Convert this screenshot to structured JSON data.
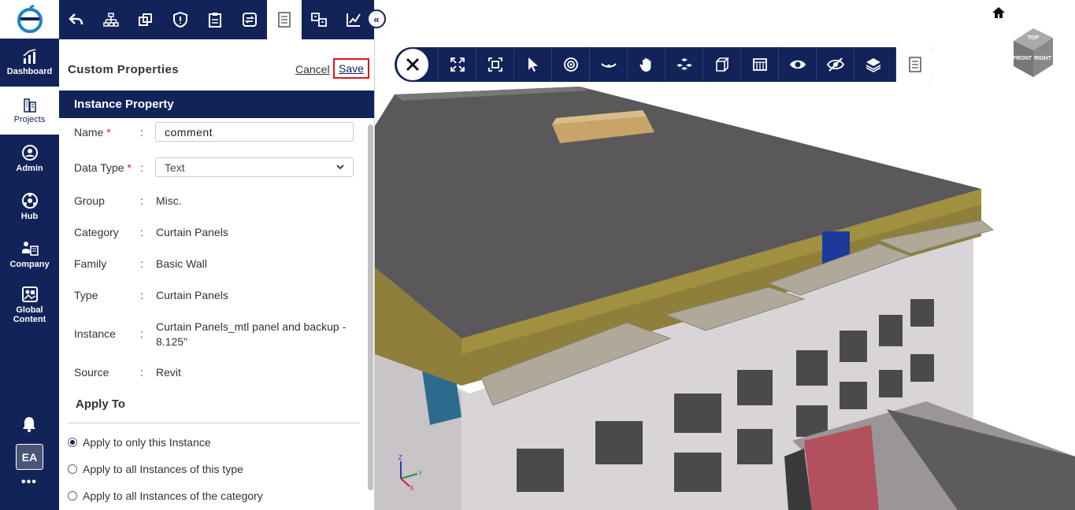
{
  "nav": {
    "items": [
      {
        "label": "Dashboard",
        "icon": "chart-icon"
      },
      {
        "label": "Projects",
        "icon": "building-icon"
      },
      {
        "label": "Admin",
        "icon": "admin-icon"
      },
      {
        "label": "Hub",
        "icon": "hub-icon"
      },
      {
        "label": "Company",
        "icon": "company-icon"
      },
      {
        "label": "Global Content",
        "icon": "global-content-icon"
      }
    ],
    "active": "Projects",
    "avatar": "EA",
    "more": "•••"
  },
  "panel": {
    "title": "Custom Properties",
    "cancel_label": "Cancel",
    "save_label": "Save",
    "section_title": "Instance Property",
    "name_label": "Name",
    "name_value": "comment",
    "datatype_label": "Data Type",
    "datatype_value": "Text",
    "required_mark": "*",
    "colon": ":",
    "fields": [
      {
        "label": "Group",
        "value": "Misc."
      },
      {
        "label": "Category",
        "value": "Curtain Panels"
      },
      {
        "label": "Family",
        "value": "Basic Wall"
      },
      {
        "label": "Type",
        "value": "Curtain Panels"
      },
      {
        "label": "Instance",
        "value": "Curtain Panels_mtl panel and backup - 8.125\""
      },
      {
        "label": "Source",
        "value": "Revit"
      }
    ],
    "apply_title": "Apply To",
    "apply_options": [
      {
        "label": "Apply to only this Instance",
        "selected": true
      },
      {
        "label": "Apply to all Instances of this type",
        "selected": false
      },
      {
        "label": "Apply to all Instances of the category",
        "selected": false
      }
    ]
  },
  "viewer": {
    "cube_labels": [
      "TOP",
      "FRONT",
      "RIGHT"
    ],
    "axes": [
      "Z",
      "Y",
      "X"
    ]
  },
  "colors": {
    "navy": "#12235a",
    "accent_red": "#e0141e"
  }
}
